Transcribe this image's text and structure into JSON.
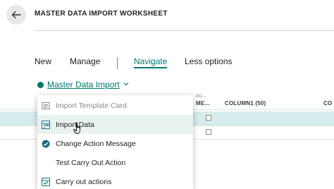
{
  "header": {
    "title": "MASTER DATA IMPORT WORKSHEET",
    "back_icon": "arrow-left-icon"
  },
  "actions": [
    {
      "label": "New"
    },
    {
      "label": "Manage"
    },
    {
      "label": "Navigate"
    },
    {
      "label": "Less options"
    }
  ],
  "dropdown": {
    "label": "Master Data Import",
    "chevron_icon": "chevron-down-icon"
  },
  "menu": {
    "items": [
      {
        "label": "Import Template Card",
        "icon": "template-card-icon"
      },
      {
        "label": "Import Data",
        "icon": "import-data-icon"
      },
      {
        "label": "Change Action Message",
        "icon": "change-action-icon"
      },
      {
        "label": "Test Carry Out Action",
        "icon": ""
      },
      {
        "label": "Carry out actions",
        "icon": "carry-out-icon"
      }
    ]
  },
  "grid": {
    "columns": [
      "AC...",
      "ME...",
      "COLUMN1 (50)",
      "CO"
    ]
  },
  "colors": {
    "accent": "#00786f",
    "selected_row": "#d6ecec",
    "hover": "#e8f2ef"
  }
}
